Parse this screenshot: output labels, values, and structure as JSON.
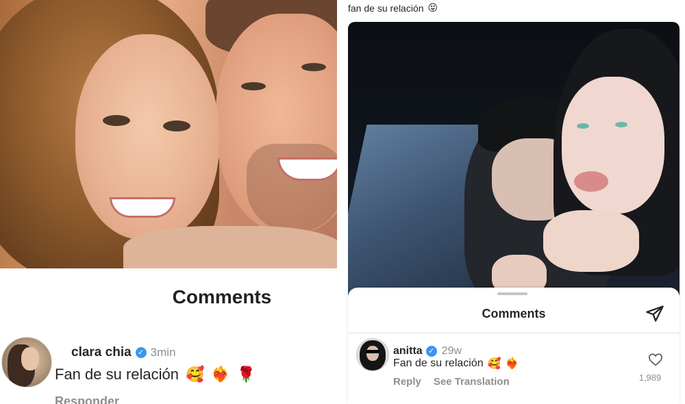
{
  "left": {
    "comments_title": "Comments",
    "comment": {
      "username": "clara chia",
      "time": "3min",
      "text": "Fan de su relación",
      "emojis": [
        "🥰",
        "❤️‍🔥",
        "🌹"
      ],
      "reply_label": "Responder"
    }
  },
  "right": {
    "caption": "fan de su relación",
    "caption_emoji": "😝",
    "comments_title": "Comments",
    "comment": {
      "username": "anitta",
      "time": "29w",
      "text": "Fan de su relación",
      "emojis": [
        "🥰",
        "❤️‍🔥"
      ],
      "reply_label": "Reply",
      "translation_label": "See Translation",
      "like_count": "1,989"
    }
  },
  "colors": {
    "verified": "#3897f0",
    "muted_text": "#8e8e8e",
    "primary_text": "#262626"
  },
  "icons": [
    "verified-badge-icon",
    "send-icon",
    "heart-icon"
  ]
}
